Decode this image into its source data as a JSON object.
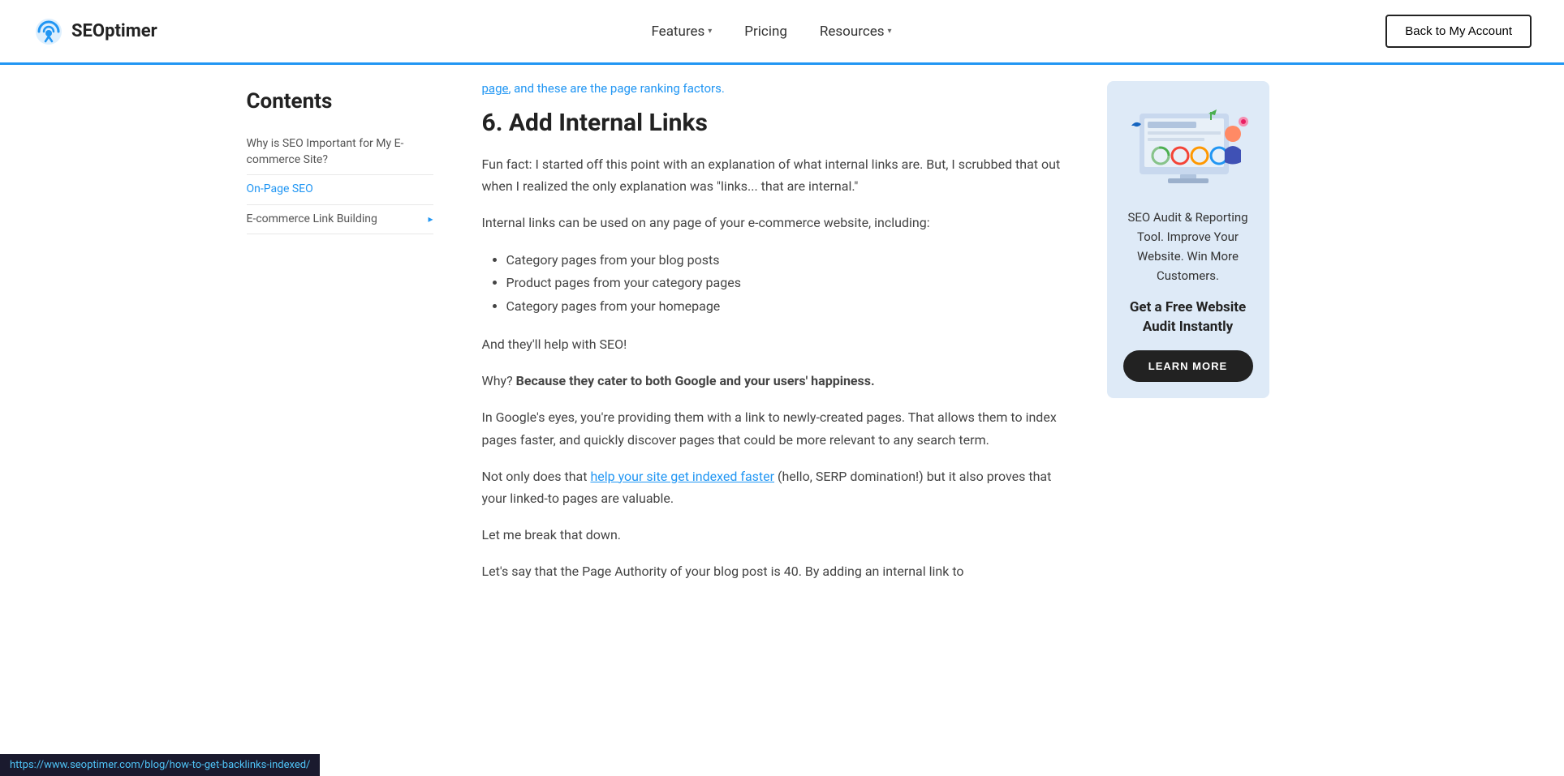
{
  "header": {
    "logo_text": "SEOptimer",
    "nav_items": [
      {
        "label": "Features",
        "has_dropdown": true
      },
      {
        "label": "Pricing",
        "has_dropdown": false
      },
      {
        "label": "Resources",
        "has_dropdown": true
      }
    ],
    "back_button": "Back to My Account"
  },
  "sidebar": {
    "title": "Contents",
    "items": [
      {
        "label": "Why is SEO Important for My E-commerce Site?",
        "active": false,
        "has_arrow": false
      },
      {
        "label": "On-Page SEO",
        "active": true,
        "has_arrow": false
      },
      {
        "label": "E-commerce Link Building",
        "active": false,
        "has_arrow": true
      }
    ]
  },
  "main": {
    "top_text": "page, and these are the page ranking factors.",
    "section_number": "6.",
    "section_title": "Add Internal Links",
    "paragraphs": [
      "Fun fact: I started off this point with an explanation of what internal links are. But, I scrubbed that out when I realized the only explanation was \"links... that are internal.\"",
      "Internal links can be used on any page of your e-commerce website, including:",
      "",
      "And they'll help with SEO!",
      "",
      "In Google's eyes, you're providing them with a link to newly-created pages. That allows them to index pages faster, and quickly discover pages that could be more relevant to any search term.",
      "",
      "Not only does that {link} (hello, SERP domination!) but it also proves that your linked-to pages are valuable.",
      "Let me break that down.",
      "Let's say that the Page Authority of your blog post is 40. By adding an internal link to"
    ],
    "bold_why": "Why?",
    "bold_because": "Because they cater to both Google and your users' happiness.",
    "bullets": [
      "Category pages from your blog posts",
      "Product pages from your category pages",
      "Category pages from your homepage"
    ],
    "link_text": "help your site get indexed faster"
  },
  "cta": {
    "tool_text": "SEO Audit & Reporting Tool. Improve Your Website. Win More Customers.",
    "headline": "Get a Free Website Audit Instantly",
    "button_label": "LEARN MORE"
  },
  "status_bar": {
    "url": "https://www.seoptimer.com/blog/how-to-get-backlinks-indexed/"
  }
}
